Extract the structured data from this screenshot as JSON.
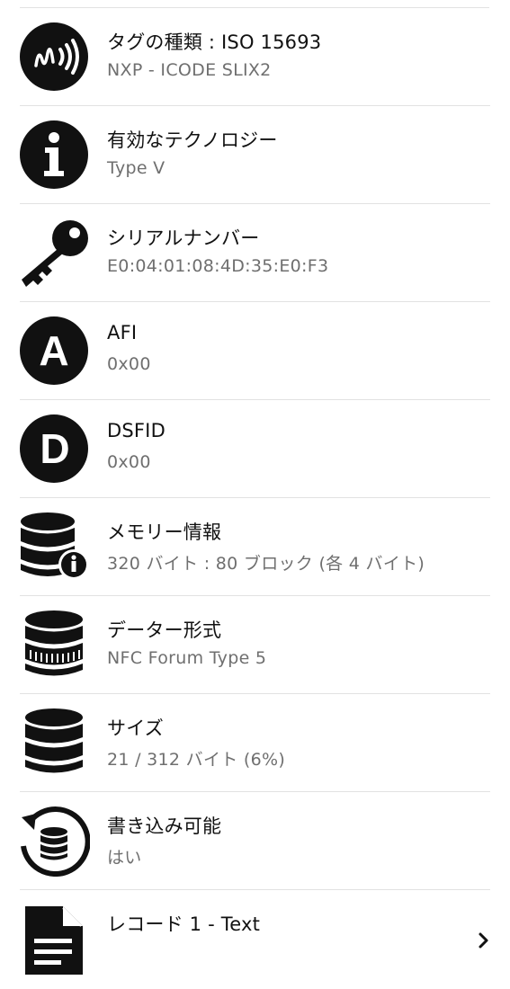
{
  "rows": [
    {
      "title": "タグの種類 : ISO 15693",
      "subtitle": "NXP - ICODE SLIX2",
      "icon": "nfc-wave-icon"
    },
    {
      "title": "有効なテクノロジー",
      "subtitle": "Type V",
      "icon": "info-icon"
    },
    {
      "title": "シリアルナンバー",
      "subtitle": "E0:04:01:08:4D:35:E0:F3",
      "icon": "key-icon"
    },
    {
      "title": "AFI",
      "subtitle": "0x00",
      "icon": "letter-a-icon"
    },
    {
      "title": "DSFID",
      "subtitle": "0x00",
      "icon": "letter-d-icon"
    },
    {
      "title": "メモリー情報",
      "subtitle": "320 バイト : 80 ブロック (各 4 バイト)",
      "icon": "database-info-icon"
    },
    {
      "title": "データー形式",
      "subtitle": "NFC Forum Type 5",
      "icon": "database-format-icon"
    },
    {
      "title": "サイズ",
      "subtitle": "21 / 312 バイト (6%)",
      "icon": "database-icon"
    },
    {
      "title": "書き込み可能",
      "subtitle": "はい",
      "icon": "database-refresh-icon"
    },
    {
      "title": "レコード 1 - Text",
      "subtitle": "",
      "icon": "document-icon"
    }
  ],
  "colors": {
    "text": "#111111",
    "subtext": "#6f6f6f",
    "divider": "#e2e2e2",
    "icon": "#111111"
  }
}
